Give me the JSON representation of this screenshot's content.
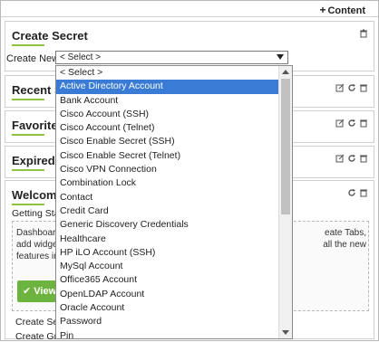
{
  "header": {
    "add_content_label": "Content",
    "plus": "+"
  },
  "widgets": {
    "create_secret": {
      "title": "Create Secret",
      "create_new_label": "Create New",
      "selected_value": "< Select >"
    },
    "recent": {
      "title": "Recent Secrets"
    },
    "favorites": {
      "title": "Favorite Secrets"
    },
    "expired": {
      "title": "Expired Secrets"
    },
    "welcome": {
      "title": "Welcome",
      "subtitle": "Getting Started",
      "text_line1": "Dashboard",
      "text_line1_right": "eate Tabs,",
      "text_line2": "add widget",
      "text_line2_right": "all the new",
      "text_line3": "features in",
      "view_button": "View",
      "below1": "Create Sec",
      "below2": "Create Gro"
    }
  },
  "dropdown": {
    "selected_index": 1,
    "options": [
      "< Select >",
      "Active Directory Account",
      "Bank Account",
      "Cisco Account (SSH)",
      "Cisco Account (Telnet)",
      "Cisco Enable Secret (SSH)",
      "Cisco Enable Secret (Telnet)",
      "Cisco VPN Connection",
      "Combination Lock",
      "Contact",
      "Credit Card",
      "Generic Discovery Credentials",
      "Healthcare",
      "HP iLO Account (SSH)",
      "MySql Account",
      "Office365 Account",
      "OpenLDAP Account",
      "Oracle Account",
      "Password",
      "Pin"
    ]
  },
  "colors": {
    "accent": "#8cc43f",
    "selection": "#3a7bd5",
    "button": "#6db33f"
  }
}
